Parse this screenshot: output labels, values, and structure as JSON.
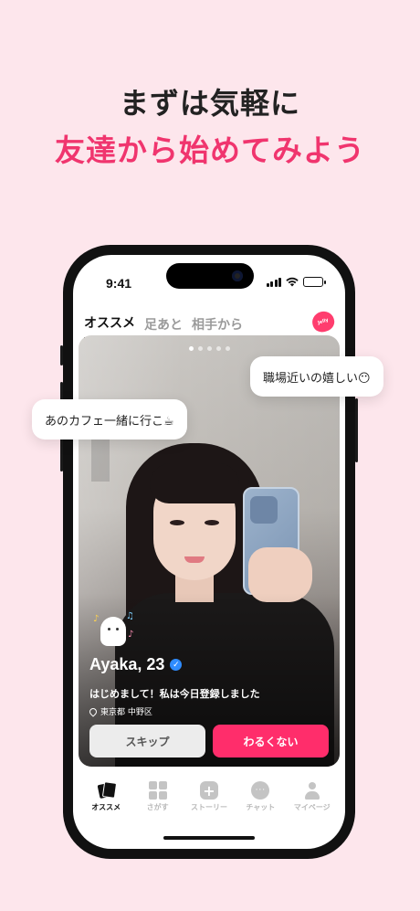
{
  "headline": {
    "line1": "まずは気軽に",
    "line2": "友達から始めてみよう"
  },
  "colors": {
    "background": "#fde6ec",
    "accent": "#f0356e",
    "like_button": "#ff2d6b",
    "verified": "#2f8cff"
  },
  "status_bar": {
    "time": "9:41",
    "icons": [
      "signal-icon",
      "wifi-icon",
      "battery-icon"
    ]
  },
  "tabs": [
    {
      "label": "オススメ",
      "active": true
    },
    {
      "label": "足あと",
      "active": false
    },
    {
      "label": "相手から",
      "active": false
    }
  ],
  "jelly_badge": {
    "label": "Jelly",
    "icon": "jelly-icon"
  },
  "profile_card": {
    "photo_pages": 5,
    "current_page": 1,
    "name": "Ayaka, 23",
    "verified_mark": "✓",
    "bio": "はじめまして！私は今日登録しました",
    "location": "東京都 中野区",
    "skip_label": "スキップ",
    "like_label": "わるくない"
  },
  "bubbles": [
    {
      "text": "職場近いの嬉しい😶"
    },
    {
      "text": "あのカフェ一緒に行こ☕"
    }
  ],
  "bottom_nav": [
    {
      "label": "オススメ",
      "icon": "cards-icon",
      "active": true
    },
    {
      "label": "さがす",
      "icon": "grid-icon",
      "active": false
    },
    {
      "label": "ストーリー",
      "icon": "plus-icon",
      "active": false
    },
    {
      "label": "チャット",
      "icon": "chat-icon",
      "active": false
    },
    {
      "label": "マイページ",
      "icon": "user-icon",
      "active": false
    }
  ]
}
